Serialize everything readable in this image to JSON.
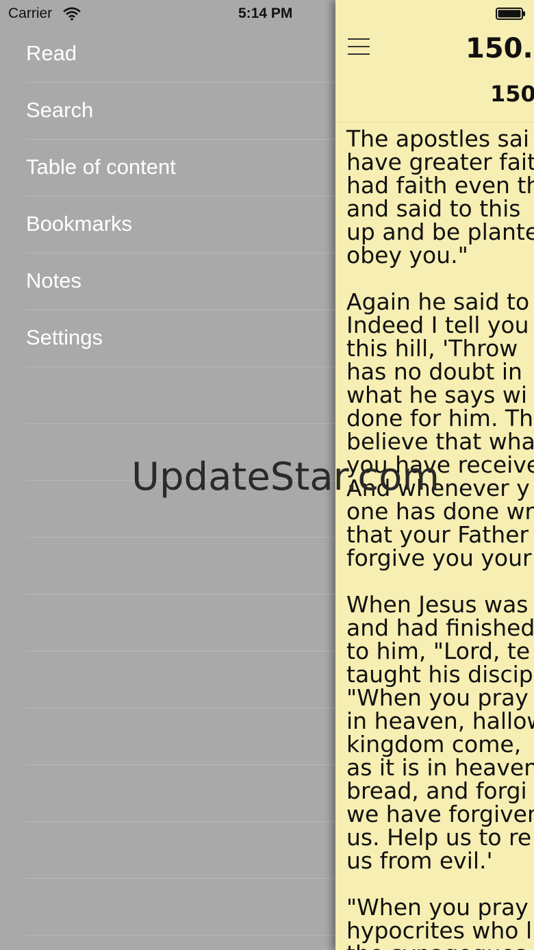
{
  "status_bar": {
    "carrier": "Carrier",
    "time": "5:14 PM"
  },
  "menu": {
    "items": [
      {
        "label": "Read"
      },
      {
        "label": "Search"
      },
      {
        "label": "Table of content"
      },
      {
        "label": "Bookmarks"
      },
      {
        "label": "Notes"
      },
      {
        "label": "Settings"
      }
    ],
    "empty_rows": 10
  },
  "reader": {
    "title": "150.",
    "subtitle": "150",
    "paragraphs": [
      "The apostles sai\nhave greater fait\nhad faith even th\nand said to this \nup and be plante\nobey you.\"",
      "Again he said to\nIndeed I tell you\nthis hill, 'Throw \nhas no doubt in \nwhat he says wi\ndone for him. Th\nbelieve that wha\nyou have receive\nAnd whenever y\none has done wr\nthat your Father\nforgive you your",
      "When Jesus was\nand had finished\nto him, \"Lord, te\ntaught his discip\n\"When you pray\nin heaven, hallow\nkingdom come, \nas it is in heaven\nbread, and forgi\nwe have forgiven\nus. Help us to re\nus from evil.'",
      "\"When you pray\nhypocrites who l\nthe synagogues"
    ]
  },
  "watermark": "UpdateStar.com",
  "icons": {
    "wifi": "wifi-icon",
    "battery": "battery-icon",
    "menu": "hamburger-menu-icon"
  }
}
